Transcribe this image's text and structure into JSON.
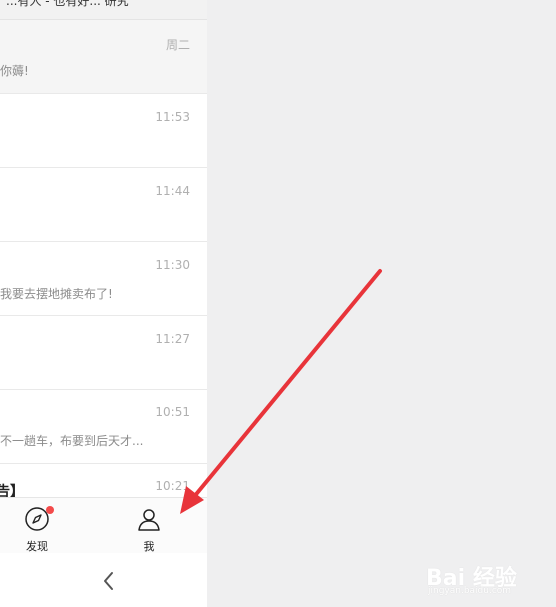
{
  "header": {
    "partial_title": "...有人 - 也有好... 研究"
  },
  "chats": [
    {
      "time": "周二",
      "title": "",
      "preview": "你薅!",
      "pinned": true
    },
    {
      "time": "11:53",
      "title": "",
      "preview": ""
    },
    {
      "time": "11:44",
      "title": "",
      "preview": ""
    },
    {
      "time": "11:30",
      "title": "",
      "preview": "我要去摆地摊卖布了!"
    },
    {
      "time": "11:27",
      "title": "",
      "preview": ""
    },
    {
      "time": "10:51",
      "title": "",
      "preview": "不一趟车，布要到后天才..."
    },
    {
      "time": "10:21",
      "title": "告】",
      "preview": ""
    }
  ],
  "tabbar": {
    "discover": {
      "label": "发现",
      "icon": "compass-icon",
      "has_badge": true
    },
    "me": {
      "label": "我",
      "icon": "person-icon"
    }
  },
  "navbar": {
    "back_icon": "chevron-left-icon"
  },
  "watermark": {
    "text": "Bai 经验",
    "sub": "jingyan.baidu.com"
  },
  "colors": {
    "badge": "#f34a4a",
    "annotation_arrow": "#e8343a",
    "page_bg": "#efeff0"
  }
}
